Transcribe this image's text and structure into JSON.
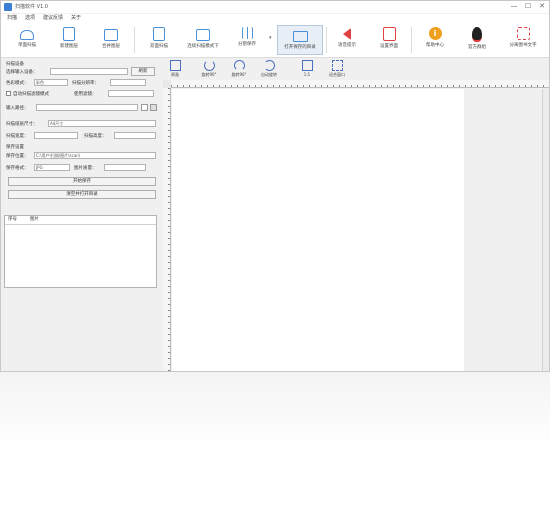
{
  "window": {
    "title": "扫描软件 V1.0",
    "controls": [
      "—",
      "☐",
      "✕"
    ]
  },
  "menu": [
    "扫描",
    "选项",
    "建议反馈",
    "关于"
  ],
  "toolbar": [
    {
      "label": "单面扫描",
      "icon": "scanner-icon",
      "color": "#4a90d9"
    },
    {
      "label": "新建图层",
      "icon": "new-doc-icon",
      "color": "#4a90d9"
    },
    {
      "label": "合并图层",
      "icon": "merge-icon",
      "color": "#4a90d9"
    },
    {
      "label": "双面扫描",
      "icon": "duplex-scan-icon",
      "color": "#4a90d9"
    },
    {
      "label": "连续扫描模式下",
      "icon": "continuous-scan-icon",
      "color": "#4a90d9"
    },
    {
      "label": "分割保存",
      "icon": "split-save-icon",
      "color": "#4a90d9"
    },
    {
      "label": "打开保存的目录",
      "icon": "folder-icon",
      "color": "#4a90d9"
    },
    {
      "label": "语音提示",
      "icon": "speaker-icon",
      "color": "#e04040"
    },
    {
      "label": "设置界面",
      "icon": "settings-panel-icon",
      "color": "#e04040"
    },
    {
      "label": "帮助中心",
      "icon": "info-icon",
      "color": "#f0a020"
    },
    {
      "label": "官方群组",
      "icon": "qq-icon",
      "color": "#222222"
    },
    {
      "label": "分离图书文字",
      "icon": "expand-icon",
      "color": "#e04040"
    }
  ],
  "left": {
    "device_group": "扫描设备",
    "device_label": "选择输入设备：",
    "device_value": "",
    "device_button": "刷新",
    "color_label": "色彩模式：",
    "color_value": "彩色",
    "dpi_label": "扫描分辨率：",
    "dpi_value": "",
    "auto_label": "自动扫描滤镜模式",
    "auto_sub": "使用滤镜：",
    "input_label": "输入路径：",
    "paper_label": "扫描纸张尺寸：",
    "paper_value": "A4尺寸",
    "width_label": "扫描宽度：",
    "height_label": "扫描高度：",
    "save_group": "保存设置",
    "save_path_label": "保存位置：",
    "save_path_value": "C:\\用户\\扫描\\图片\\scan\\",
    "format_label": "保存格式：",
    "format_value": "JPG",
    "quality_label": "图片质量：",
    "start_button": "开始保存",
    "clear_button": "清空并打开目录",
    "list_headers": [
      "序号",
      "图片"
    ]
  },
  "image_tools": [
    {
      "label": "原画",
      "icon": "original-icon"
    },
    {
      "label": "旋转90°",
      "icon": "rotate-cw-icon"
    },
    {
      "label": "旋转90°",
      "icon": "rotate-ccw-icon"
    },
    {
      "label": "自动旋转",
      "icon": "auto-rotate-icon"
    },
    {
      "label": "1:1",
      "icon": "actual-size-icon"
    },
    {
      "label": "适合窗口",
      "icon": "fit-window-icon"
    }
  ]
}
